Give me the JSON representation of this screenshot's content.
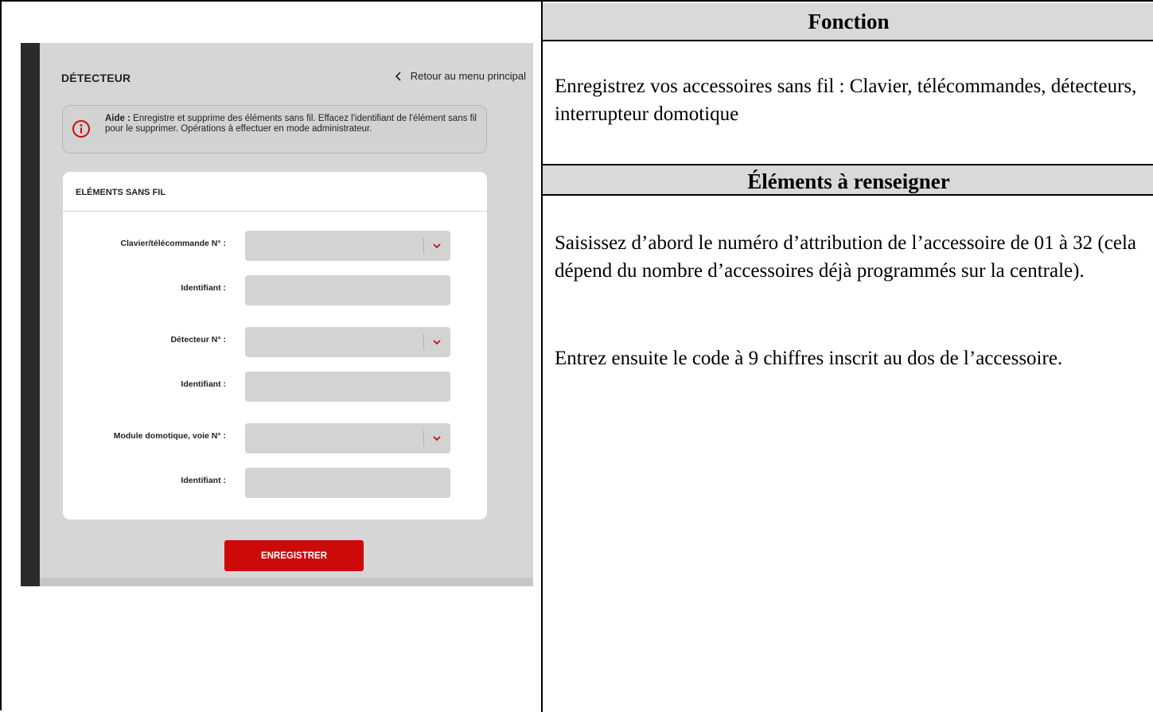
{
  "headers": {
    "fonction": "Fonction",
    "elements": "Éléments à renseigner"
  },
  "paragraphs": {
    "fonction_text": "Enregistrez vos accessoires sans fil : Clavier, télécommandes, détecteurs, interrupteur domotique",
    "elements_text_1": "Saisissez d’abord le numéro d’attribution de l’accessoire de 01 à 32 (cela dépend du nombre d’accessoires déjà programmés sur la centrale).",
    "elements_text_2": "Entrez ensuite le code à 9 chiffres inscrit au dos de l’accessoire."
  },
  "screen": {
    "title": "DÉTECTEUR",
    "back_link": "Retour au menu principal",
    "help": {
      "label": "Aide :",
      "text": " Enregistre et supprime des éléments sans fil. Effacez l'identifiant de l'élément sans fil pour le supprimer. Opérations à effectuer en mode administrateur."
    },
    "card_title": "ELÉMENTS SANS FIL",
    "fields": {
      "keypad_label": "Clavier/télécommande N° :",
      "keypad_id_label": "Identifiant :",
      "detector_label": "Détecteur N° :",
      "detector_id_label": "Identifiant :",
      "module_label": "Module domotique, voie N° :",
      "module_id_label": "Identifiant :"
    },
    "save_button": "ENREGISTRER"
  },
  "colors": {
    "accent_red": "#cc0a0a",
    "header_gray": "#d9d9d9",
    "screen_bg": "#d6d6d6"
  },
  "icons": {
    "back": "chevron-left-icon",
    "help": "info-circle-icon",
    "select": "chevron-down-icon"
  }
}
